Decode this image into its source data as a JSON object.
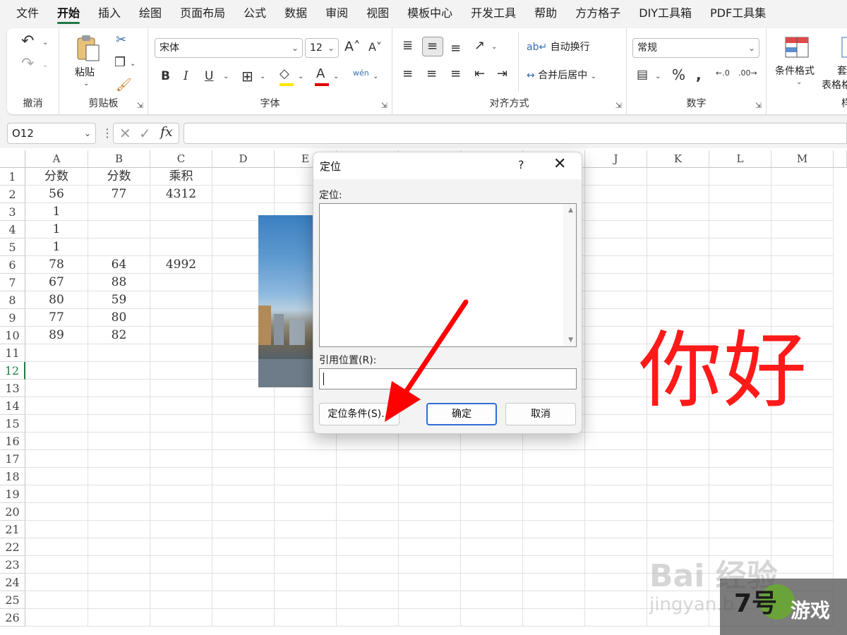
{
  "menu": [
    "文件",
    "开始",
    "插入",
    "绘图",
    "页面布局",
    "公式",
    "数据",
    "审阅",
    "视图",
    "模板中心",
    "开发工具",
    "帮助",
    "方方格子",
    "DIY工具箱",
    "PDF工具集"
  ],
  "ribbon": {
    "undo_group": "撤消",
    "clipboard": {
      "paste": "粘贴",
      "label": "剪贴板"
    },
    "font": {
      "name": "宋体",
      "size": "12",
      "label": "字体"
    },
    "alignment": {
      "wrap": "自动换行",
      "merge": "合并后居中",
      "label": "对齐方式"
    },
    "number": {
      "format": "常规",
      "label": "数字",
      "percent": "%"
    },
    "styles": {
      "conditional": "条件格式",
      "table_top": "套",
      "table_bottom": "表格格",
      "label": "样"
    }
  },
  "formula_bar": {
    "cell_ref": "O12",
    "fx": "fx"
  },
  "columns": [
    "A",
    "B",
    "C",
    "D",
    "E",
    "F",
    "G",
    "H",
    "I",
    "J",
    "K",
    "L",
    "M"
  ],
  "rows": [
    "1",
    "2",
    "3",
    "4",
    "5",
    "6",
    "7",
    "8",
    "9",
    "10",
    "11",
    "12",
    "13",
    "14",
    "15",
    "16",
    "17",
    "18",
    "19",
    "20",
    "21",
    "22",
    "23",
    "24",
    "25",
    "26"
  ],
  "active_row": "12",
  "cells": [
    [
      "分数",
      "分数",
      "乘积"
    ],
    [
      "56",
      "77",
      "4312"
    ],
    [
      "1",
      "",
      ""
    ],
    [
      "1",
      "",
      ""
    ],
    [
      "1",
      "",
      ""
    ],
    [
      "78",
      "64",
      "4992"
    ],
    [
      "67",
      "88",
      ""
    ],
    [
      "80",
      "59",
      ""
    ],
    [
      "77",
      "80",
      ""
    ],
    [
      "89",
      "82",
      ""
    ]
  ],
  "big_text": "你好",
  "dialog": {
    "title": "定位",
    "help": "?",
    "list_label": "定位:",
    "ref_label": "引用位置(R):",
    "special_button": "定位条件(S)...",
    "ok_button": "确定",
    "cancel_button": "取消"
  },
  "watermarks": {
    "baidu": "Bai 经验",
    "jingyan": "jingyan.b",
    "game_num": "7号",
    "game_text": "游戏"
  },
  "colors": {
    "accent": "#1f7a45",
    "arrow": "#ff0000",
    "big_text": "#ff1a1a",
    "dialog_primary": "#2e6fd6"
  }
}
